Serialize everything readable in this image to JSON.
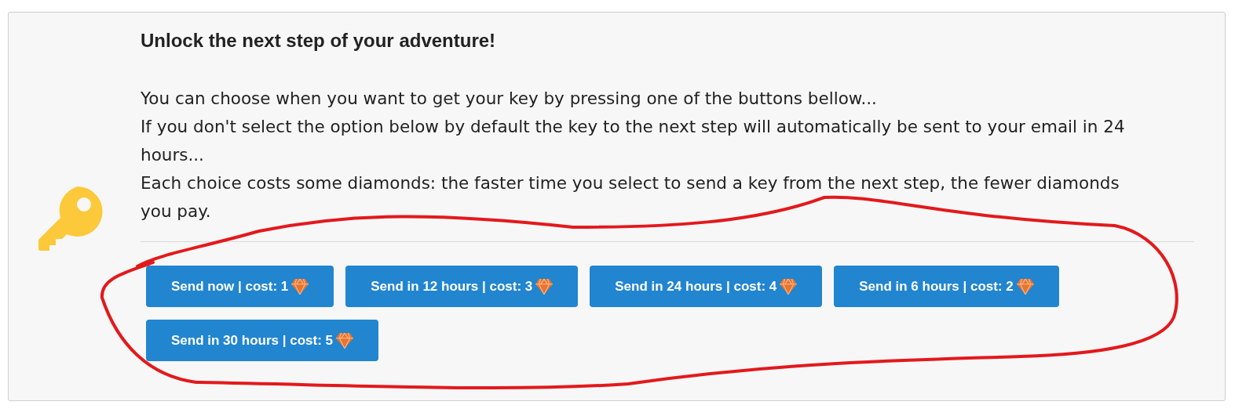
{
  "title": "Unlock the next step of your adventure!",
  "paragraphs": [
    "You can choose when you want to get your key by pressing one of the buttons bellow...",
    "If you don't select the option below by default the key to the next step will automatically be sent to your email in 24 hours...",
    "Each choice costs some diamonds: the faster time you select to send a key from the next step, the fewer diamonds you pay."
  ],
  "buttons": [
    {
      "label": "Send now | cost: 1"
    },
    {
      "label": "Send in 12 hours | cost: 3"
    },
    {
      "label": "Send in 24 hours | cost: 4"
    },
    {
      "label": "Send in 6 hours | cost: 2"
    },
    {
      "label": "Send in 30 hours | cost: 5"
    }
  ]
}
